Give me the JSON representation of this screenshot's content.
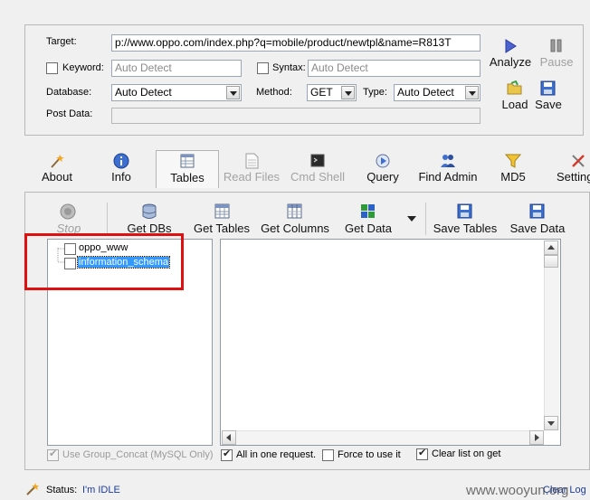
{
  "form": {
    "target_label": "Target:",
    "target_value": "p://www.oppo.com/index.php?q=mobile/product/newtpl&name=R813T",
    "keyword_label": "Keyword:",
    "keyword_placeholder": "Auto Detect",
    "syntax_label": "Syntax:",
    "syntax_placeholder": "Auto Detect",
    "database_label": "Database:",
    "database_value": "Auto Detect",
    "method_label": "Method:",
    "method_value": "GET",
    "type_label": "Type:",
    "type_value": "Auto Detect",
    "postdata_label": "Post Data:"
  },
  "actions": {
    "analyze": "Analyze",
    "pause": "Pause",
    "load": "Load",
    "save": "Save"
  },
  "tabs": [
    {
      "label": "About"
    },
    {
      "label": "Info"
    },
    {
      "label": "Tables"
    },
    {
      "label": "Read Files"
    },
    {
      "label": "Cmd Shell"
    },
    {
      "label": "Query"
    },
    {
      "label": "Find Admin"
    },
    {
      "label": "MD5"
    },
    {
      "label": "Setting"
    }
  ],
  "toolbar": {
    "stop": "Stop",
    "get_dbs": "Get DBs",
    "get_tables": "Get Tables",
    "get_columns": "Get Columns",
    "get_data": "Get Data",
    "save_tables": "Save Tables",
    "save_data": "Save Data"
  },
  "tree": {
    "items": [
      {
        "label": "oppo_www"
      },
      {
        "label": "information_schema"
      }
    ]
  },
  "options": {
    "group_concat": "Use Group_Concat (MySQL Only)",
    "all_in_one": "All in one request.",
    "force": "Force to use it",
    "clear_list": "Clear list on get"
  },
  "status": {
    "label": "Status:",
    "value": "I'm IDLE",
    "clear_log": "Clear Log",
    "watermark": "www.wooyun.org"
  },
  "colors": {
    "accent_blue": "#2a62c8",
    "selection": "#3399ff",
    "highlight_box": "#e01010"
  }
}
